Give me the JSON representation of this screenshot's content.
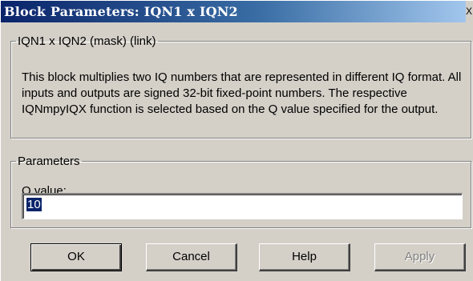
{
  "window": {
    "title": "Block Parameters: IQN1 x IQN2",
    "close_hint": "X"
  },
  "description_group": {
    "legend": "IQN1 x IQN2 (mask) (link)",
    "text": "This block multiplies two IQ numbers that are represented in different IQ format. All inputs and outputs are signed 32-bit fixed-point numbers. The respective IQNmpyIQX function is selected based on the Q value specified for the output."
  },
  "parameters_group": {
    "legend": "Parameters",
    "q_label": "Q value:",
    "q_value": "10"
  },
  "buttons": {
    "ok": "OK",
    "cancel": "Cancel",
    "help": "Help",
    "apply": "Apply"
  },
  "colors": {
    "titlebar_start": "#0a246a",
    "titlebar_end": "#a6caf0",
    "dialog_face": "#d4d0c8",
    "selection": "#0a246a"
  }
}
